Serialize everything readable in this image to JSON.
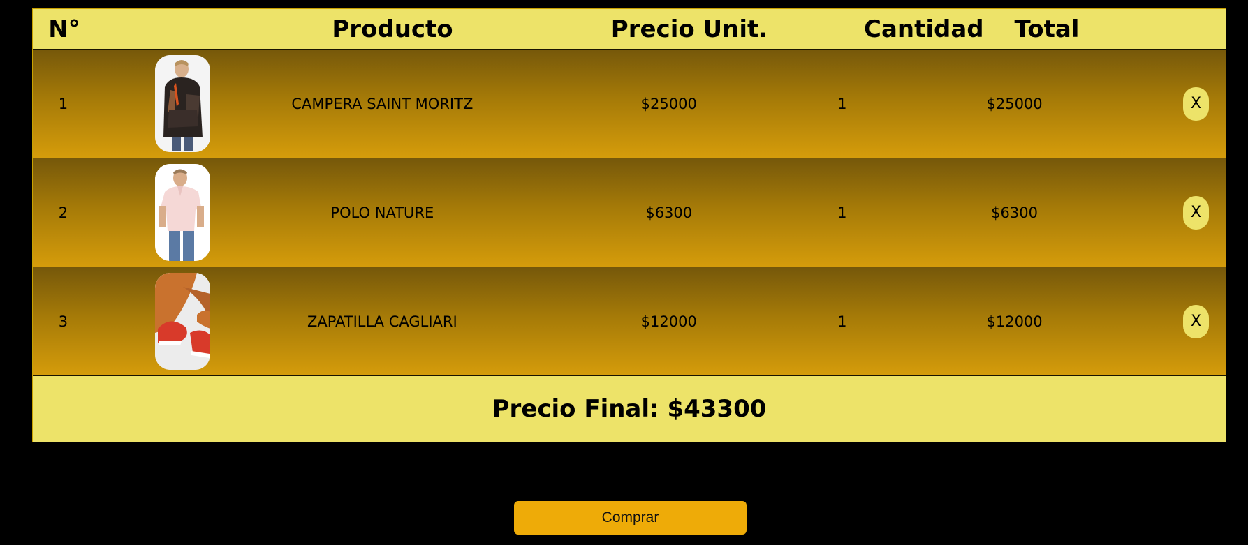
{
  "table": {
    "headers": {
      "num": "N°",
      "product": "Producto",
      "unit_price": "Precio Unit.",
      "quantity": "Cantidad",
      "total": "Total"
    },
    "rows": [
      {
        "num": "1",
        "product": "CAMPERA SAINT MORITZ",
        "unit_price": "$25000",
        "quantity": "1",
        "total": "$25000",
        "delete_label": "X",
        "image": "jacket-photo"
      },
      {
        "num": "2",
        "product": "POLO NATURE",
        "unit_price": "$6300",
        "quantity": "1",
        "total": "$6300",
        "delete_label": "X",
        "image": "polo-photo"
      },
      {
        "num": "3",
        "product": "ZAPATILLA CAGLIARI",
        "unit_price": "$12000",
        "quantity": "1",
        "total": "$12000",
        "delete_label": "X",
        "image": "sneakers-photo"
      }
    ],
    "final_price": "Precio Final: $43300"
  },
  "buy_button_label": "Comprar",
  "colors": {
    "header_bg": "#ede369",
    "row_gradient_top": "#76580a",
    "row_gradient_bottom": "#d59c0b",
    "buy_button": "#eeab08",
    "page_bg": "#000000"
  }
}
